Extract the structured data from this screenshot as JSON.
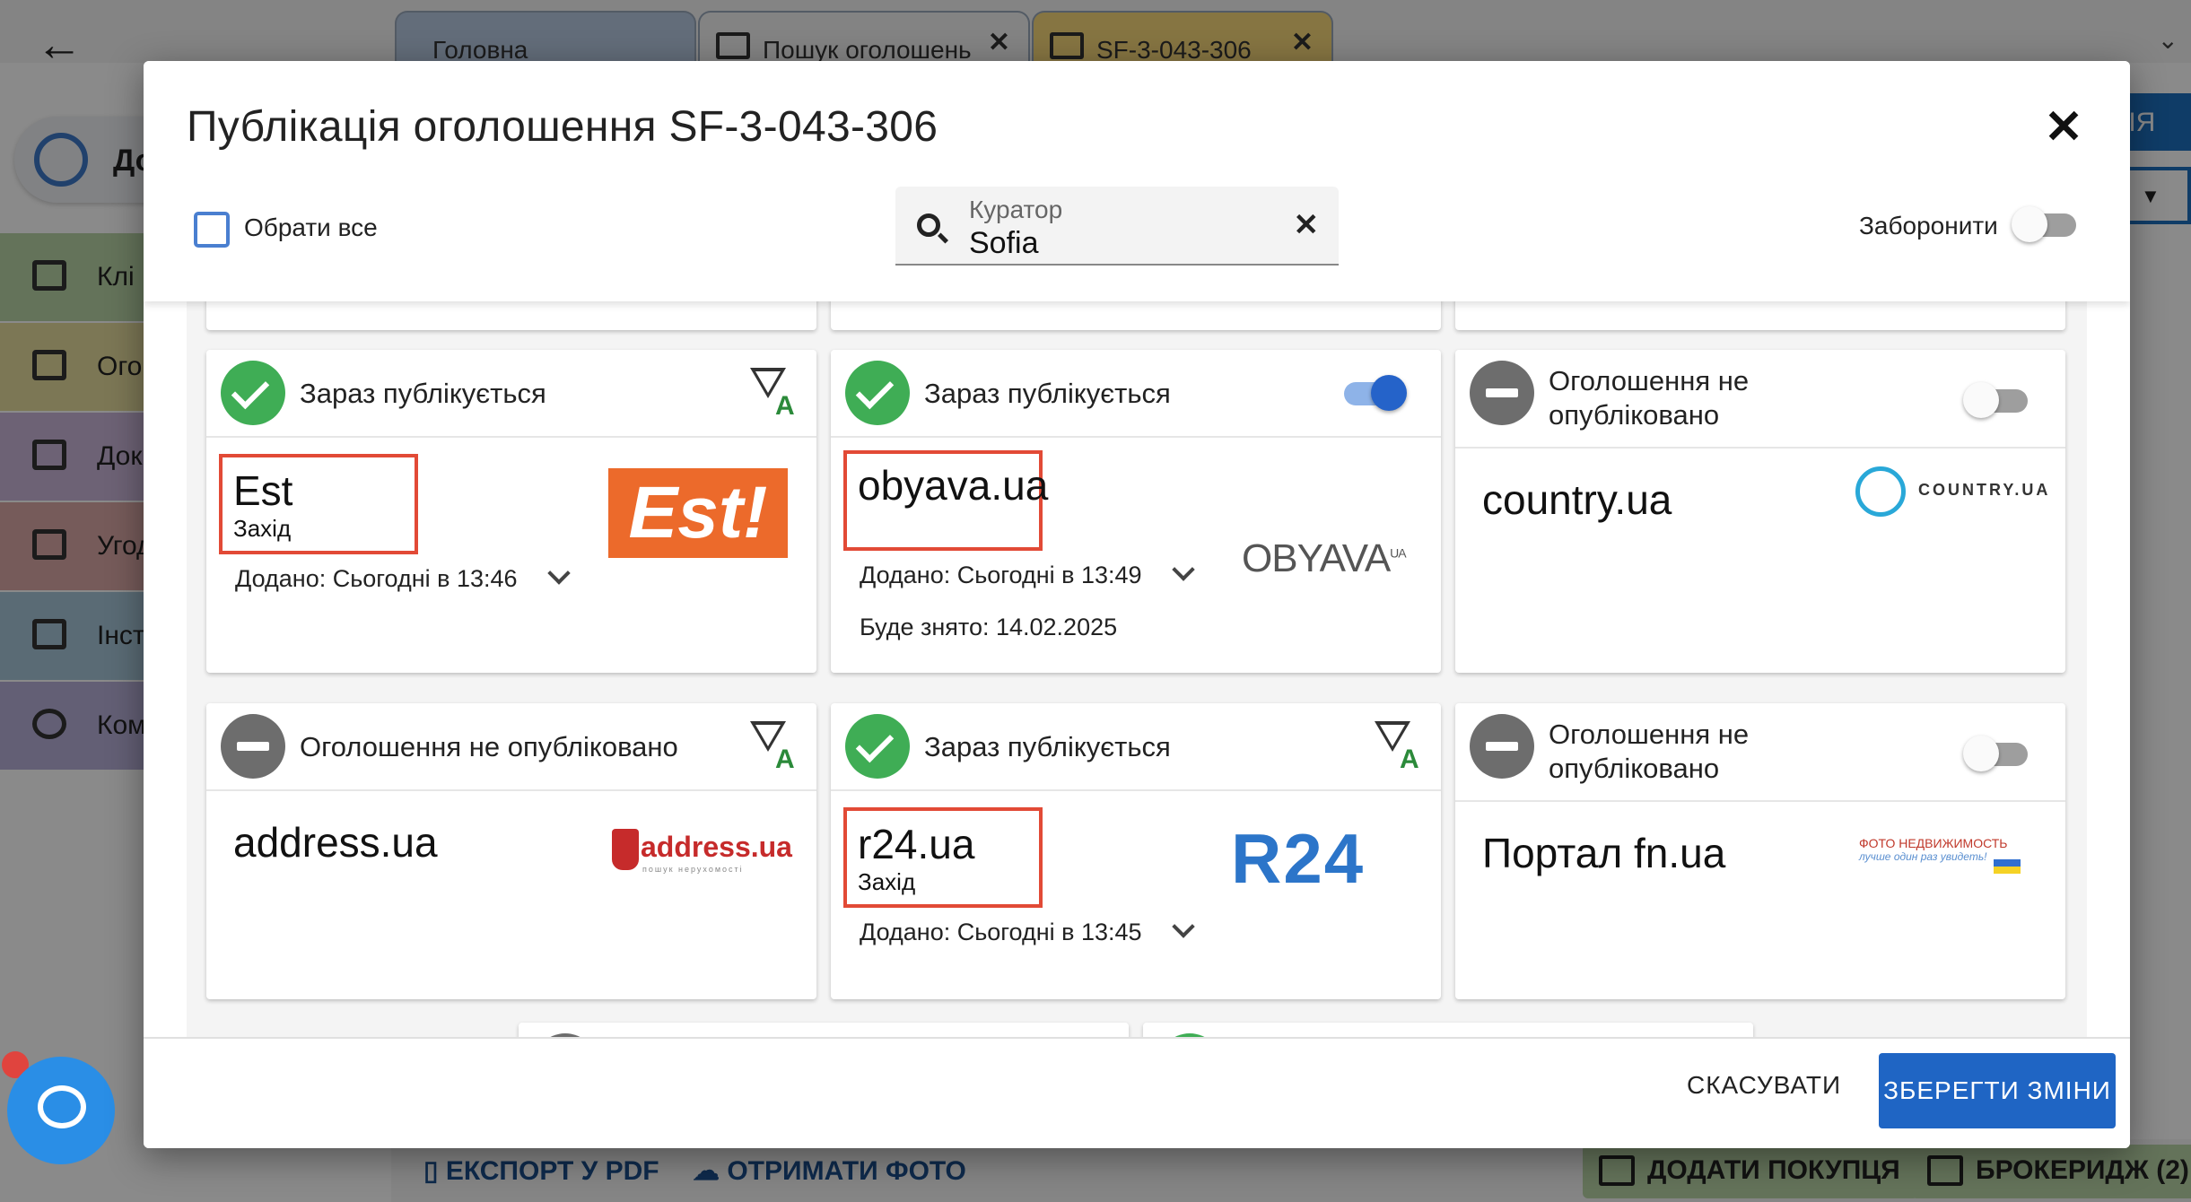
{
  "background": {
    "tabs": [
      {
        "label": "Головна"
      },
      {
        "label": "Пошук оголошень"
      },
      {
        "label": "SF-3-043-306"
      }
    ],
    "sidebar_logo_label": "До",
    "sidebar": [
      {
        "label": "Клі",
        "color": "#b9d5a6"
      },
      {
        "label": "Ого",
        "color": "#e6dc9e"
      },
      {
        "label": "Док",
        "color": "#c9b6d9"
      },
      {
        "label": "Угод",
        "color": "#dba8a6"
      },
      {
        "label": "Інст",
        "color": "#a6c6d9"
      },
      {
        "label": "Ком",
        "color": "#b7b0d9"
      }
    ],
    "right_button": "ДІЯ",
    "bottom_actions": {
      "export_pdf": "ЕКСПОРТ У PDF",
      "get_photo": "ОТРИМАТИ ФОТО",
      "add_buyer": "ДОДАТИ ПОКУПЦЯ",
      "brokerage": "БРОКЕРИДЖ (2)"
    }
  },
  "modal": {
    "title": "Публікація оголошення SF-3-043-306",
    "select_all_label": "Обрати все",
    "curator": {
      "label": "Куратор",
      "value": "Sofia"
    },
    "forbid_label": "Заборонити",
    "cancel_label": "СКАСУВАТИ",
    "save_label": "ЗБЕРЕГТИ ЗМІНИ"
  },
  "cards": [
    {
      "status": "published",
      "status_text": "Зараз публікується",
      "control": "filter",
      "site": "Est",
      "region": "Захід",
      "added": "Додано: Сьогодні в 13:46",
      "logo": "Est!",
      "highlighted": true
    },
    {
      "status": "published",
      "status_text": "Зараз публікується",
      "control": "toggle-on",
      "site": "obyava.ua",
      "added": "Додано: Сьогодні в 13:49",
      "remove": "Буде знято: 14.02.2025",
      "logo": "OBYAVA",
      "highlighted": true
    },
    {
      "status": "not_published",
      "status_text": "Оголошення не опубліковано",
      "control": "toggle-off",
      "site": "country.ua",
      "logo": "COUNTRY.UA"
    },
    {
      "status": "not_published",
      "status_text": "Оголошення не опубліковано",
      "control": "filter",
      "site": "address.ua",
      "logo": "address.ua",
      "logo_sub": "пошук нерухомості"
    },
    {
      "status": "published",
      "status_text": "Зараз публікується",
      "control": "filter",
      "site": "r24.ua",
      "region": "Захід",
      "added": "Додано: Сьогодні в 13:45",
      "logo": "R24",
      "highlighted": true
    },
    {
      "status": "not_published",
      "status_text": "Оголошення не опубліковано",
      "control": "toggle-off",
      "site": "Портал fn.ua",
      "logo": "ФОТО НЕДВИЖИМОСТЬ",
      "logo_sub": "лучше один раз увидеть!"
    }
  ],
  "colors": {
    "accent": "#1f65c4",
    "published": "#3fad55",
    "not_published": "#6d6d6d",
    "highlight": "#e24a36"
  }
}
